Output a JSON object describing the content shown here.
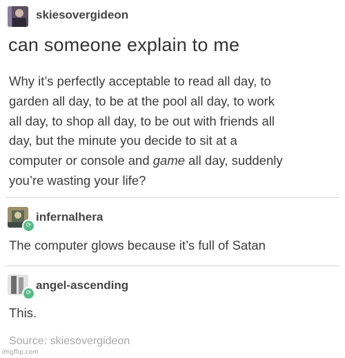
{
  "posts": [
    {
      "username": "skiesovergideon",
      "title": "can someone explain to me",
      "body_lines": [
        "Why it’s perfectly acceptable to read all day, to",
        "garden all day, to be at the pool all day, to work",
        "all day, to shop all day, to be out with friends all",
        "day, but the minute you decide to sit at a",
        "computer or console and ",
        "game",
        " all day, suddenly",
        "you’re wasting your life?"
      ]
    },
    {
      "username": "infernalhera",
      "body": "The computer glows because it’s full of Satan",
      "avatar_icon": "user-avatar-icon",
      "badge_icon": "reblog-badge-icon"
    },
    {
      "username": "angel-ascending",
      "body": "This.",
      "source": "Source: skiesovergideon",
      "avatar_icon": "user-avatar-icon",
      "badge_icon": "reblog-badge-icon"
    }
  ],
  "watermark": "imgflip.com",
  "colors": {
    "badge": "#56bc8a",
    "separator": "#d6d6d6",
    "source_text": "#a8a8a8"
  }
}
